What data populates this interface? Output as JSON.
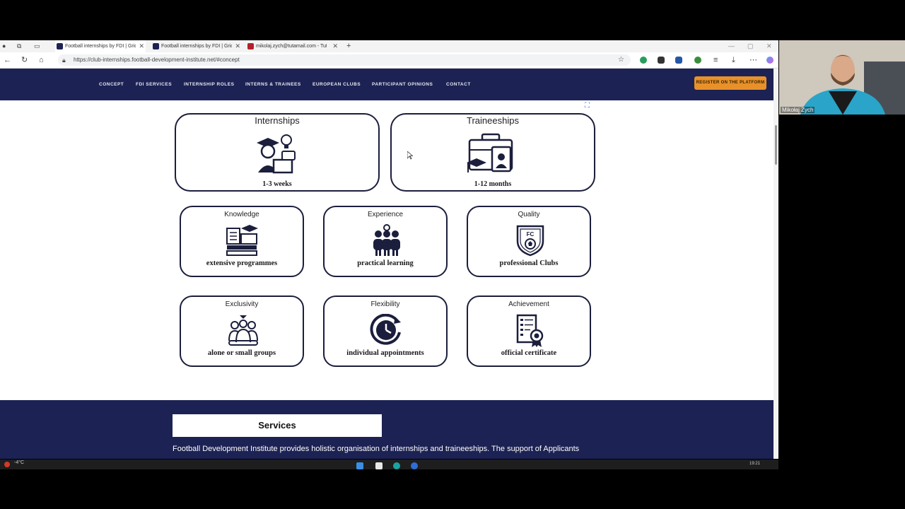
{
  "browser": {
    "tabs": [
      {
        "title": "Football internships by FDI | Grid",
        "active": true
      },
      {
        "title": "Football internships by FDI | Grid",
        "active": false
      },
      {
        "title": "mikolaj.zych@tutamail.com - Tut",
        "active": false
      }
    ],
    "new_tab": "+",
    "url": "https://club-internships.football-development-institute.net/#concept"
  },
  "site": {
    "nav": [
      "CONCEPT",
      "FDI SERVICES",
      "INTERNSHIP ROLES",
      "INTERNS & TRAINEES",
      "EUROPEAN CLUBS",
      "PARTICIPANT OPINIONS",
      "CONTACT"
    ],
    "register_label": "REGISTER ON THE PLATFORM",
    "big_cards": [
      {
        "title": "Internships",
        "subtitle": "1-3 weeks",
        "icon": "graduate-student-icon"
      },
      {
        "title": "Traineeships",
        "subtitle": "1-12 months",
        "icon": "briefcase-trainee-icon"
      }
    ],
    "cards": [
      {
        "title": "Knowledge",
        "subtitle": "extensive programmes",
        "icon": "books-icon"
      },
      {
        "title": "Experience",
        "subtitle": "practical learning",
        "icon": "team-icon"
      },
      {
        "title": "Quality",
        "subtitle": "professional Clubs",
        "icon": "club-badge-icon",
        "badge_text": "FC"
      },
      {
        "title": "Exclusivity",
        "subtitle": "alone or small groups",
        "icon": "group-icon"
      },
      {
        "title": "Flexibility",
        "subtitle": "individual appointments",
        "icon": "clock-icon"
      },
      {
        "title": "Achievement",
        "subtitle": "official certificate",
        "icon": "certificate-icon"
      }
    ],
    "services": {
      "heading": "Services",
      "text": "Football Development Institute provides holistic organisation of internships and traineeships. The support of Applicants"
    }
  },
  "taskbar": {
    "weather": "-4°C",
    "clock": "19:21"
  },
  "webcam": {
    "name": "Mikołaj Zych"
  },
  "colors": {
    "navy": "#1c2253",
    "orange": "#e8912a",
    "card_border": "#1b1e3c"
  }
}
